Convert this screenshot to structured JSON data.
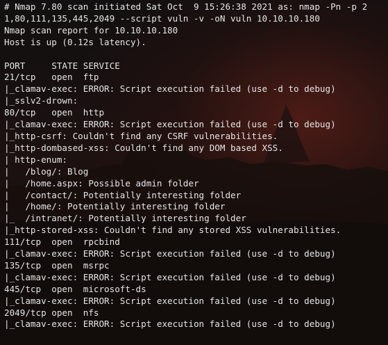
{
  "terminal": {
    "lines": [
      "# Nmap 7.80 scan initiated Sat Oct  9 15:26:38 2021 as: nmap -Pn -p 2",
      "1,80,111,135,445,2049 --script vuln -v -oN vuln 10.10.10.180",
      "Nmap scan report for 10.10.10.180",
      "Host is up (0.12s latency).",
      "",
      "PORT     STATE SERVICE",
      "21/tcp   open  ftp",
      "|_clamav-exec: ERROR: Script execution failed (use -d to debug)",
      "|_sslv2-drown:",
      "80/tcp   open  http",
      "|_clamav-exec: ERROR: Script execution failed (use -d to debug)",
      "|_http-csrf: Couldn't find any CSRF vulnerabilities.",
      "|_http-dombased-xss: Couldn't find any DOM based XSS.",
      "| http-enum:",
      "|   /blog/: Blog",
      "|   /home.aspx: Possible admin folder",
      "|   /contact/: Potentially interesting folder",
      "|   /home/: Potentially interesting folder",
      "|_  /intranet/: Potentially interesting folder",
      "|_http-stored-xss: Couldn't find any stored XSS vulnerabilities.",
      "111/tcp  open  rpcbind",
      "|_clamav-exec: ERROR: Script execution failed (use -d to debug)",
      "135/tcp  open  msrpc",
      "|_clamav-exec: ERROR: Script execution failed (use -d to debug)",
      "445/tcp  open  microsoft-ds",
      "|_clamav-exec: ERROR: Script execution failed (use -d to debug)",
      "2049/tcp open  nfs",
      "|_clamav-exec: ERROR: Script execution failed (use -d to debug)"
    ]
  },
  "colors": {
    "text": "#e6e6e6",
    "background": "#0b0b0b"
  }
}
